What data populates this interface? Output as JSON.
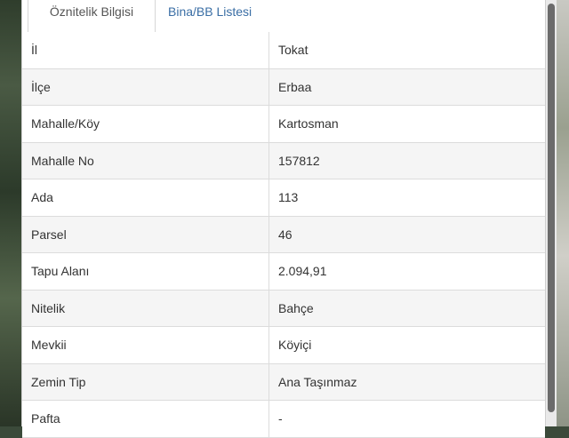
{
  "tabs": [
    {
      "label": "Öznitelik Bilgisi"
    },
    {
      "label": "Bina/BB Listesi"
    }
  ],
  "rows": [
    {
      "key": "İl",
      "value": "Tokat"
    },
    {
      "key": "İlçe",
      "value": "Erbaa"
    },
    {
      "key": "Mahalle/Köy",
      "value": "Kartosman"
    },
    {
      "key": "Mahalle No",
      "value": "157812"
    },
    {
      "key": "Ada",
      "value": "113"
    },
    {
      "key": "Parsel",
      "value": "46"
    },
    {
      "key": "Tapu Alanı",
      "value": "2.094,91"
    },
    {
      "key": "Nitelik",
      "value": "Bahçe"
    },
    {
      "key": "Mevkii",
      "value": "Köyiçi"
    },
    {
      "key": "Zemin Tip",
      "value": "Ana Taşınmaz"
    },
    {
      "key": "Pafta",
      "value": "-"
    }
  ],
  "colors": {
    "tab_active_text": "#555555",
    "tab_link_text": "#3a6ea5",
    "row_alt": "#f5f5f5"
  }
}
